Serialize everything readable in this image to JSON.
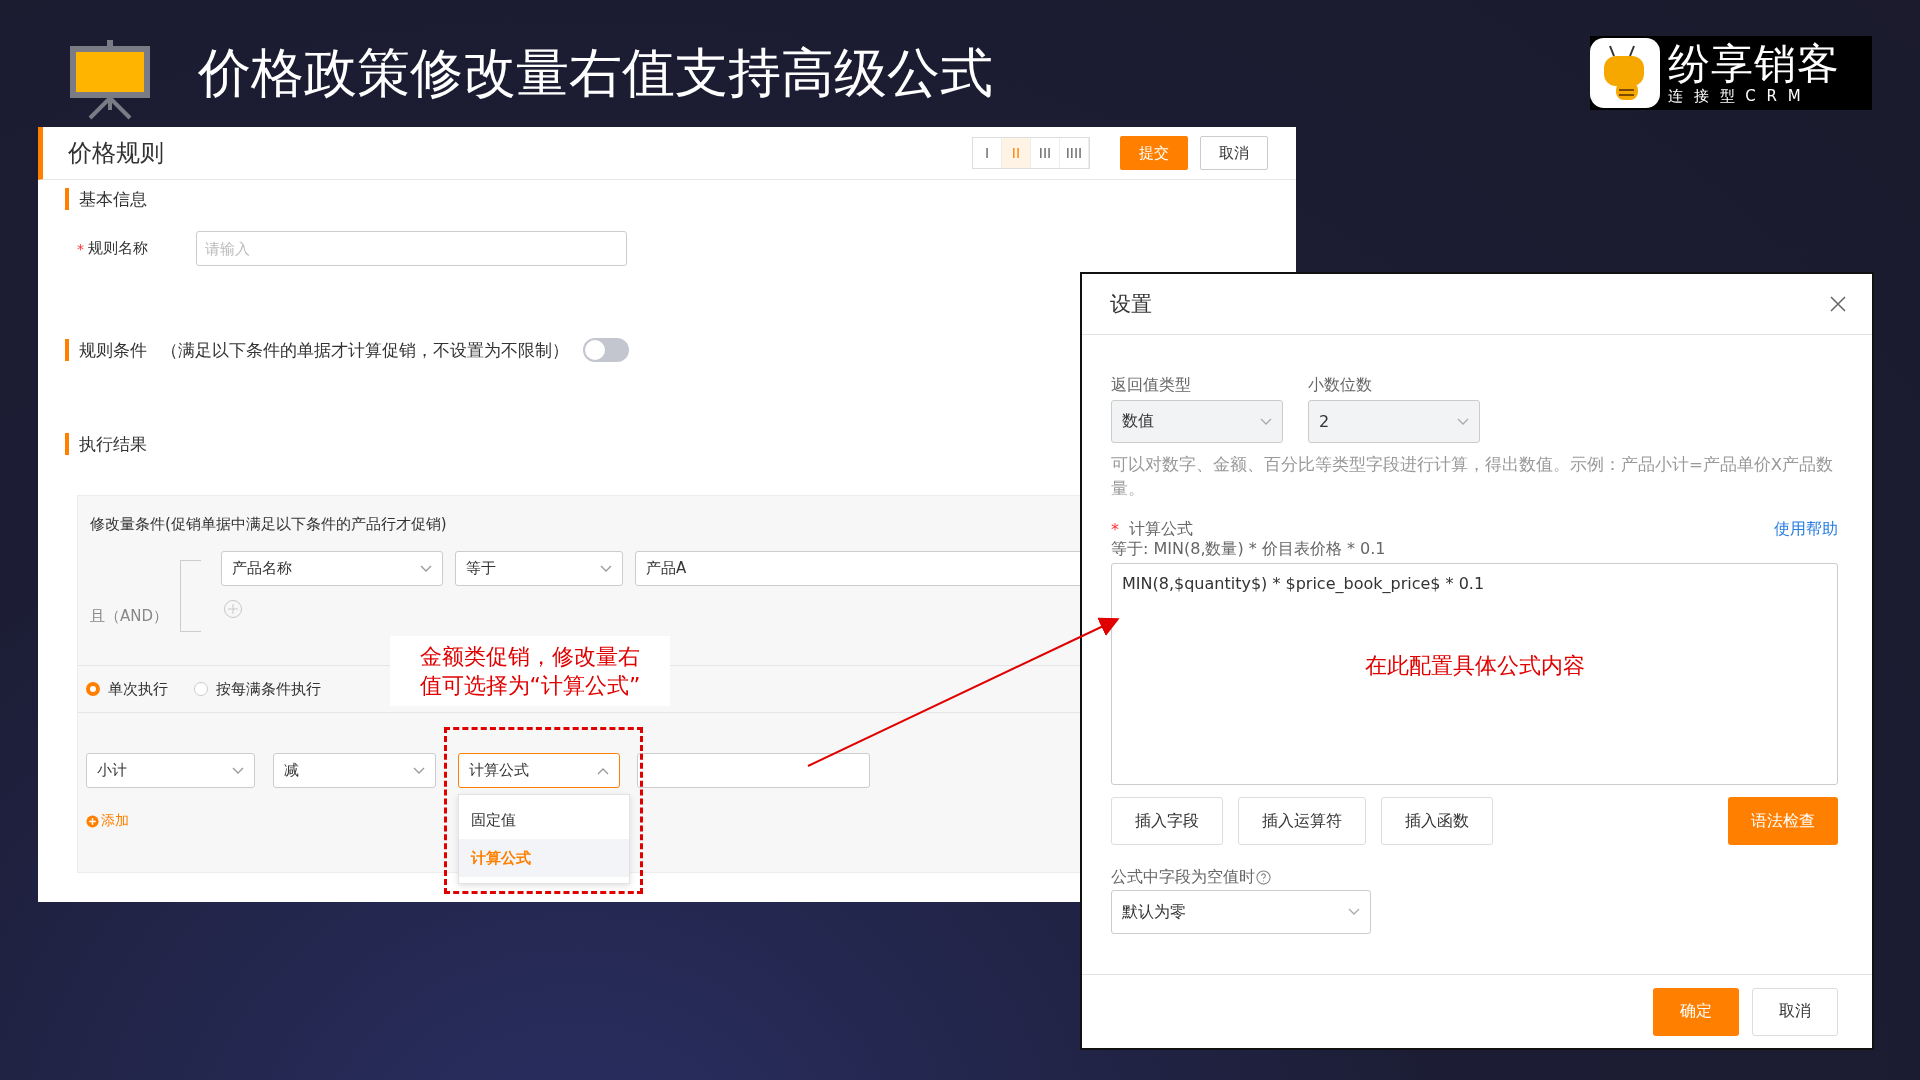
{
  "slide": {
    "title": "价格政策修改量右值支持高级公式",
    "logo": {
      "name": "纷享销客",
      "tagline": "连 接 型 C R M"
    }
  },
  "rule_panel": {
    "title": "价格规则",
    "layout_options": [
      {
        "label": "I",
        "selected": false
      },
      {
        "label": "II",
        "selected": true
      },
      {
        "label": "III",
        "selected": false
      },
      {
        "label": "IIII",
        "selected": false
      }
    ],
    "buttons": [
      {
        "label": "提交",
        "kind": "primary"
      },
      {
        "label": "取消",
        "kind": "default"
      }
    ],
    "basic_info": {
      "heading": "基本信息",
      "field": {
        "required_mark": "*",
        "label": "规则名称",
        "placeholder": "请输入"
      }
    },
    "conditions": {
      "heading": "规则条件",
      "note": "（满足以下条件的单据才计算促销，不设置为不限制）",
      "toggle": {
        "on": false
      }
    },
    "result": {
      "heading": "执行结果",
      "condition_title": "修改量条件(促销单据中满足以下条件的产品行才促销)",
      "logic": "且（AND）",
      "filter": [
        {
          "value": "产品名称",
          "kind": "select"
        },
        {
          "value": "等于",
          "kind": "select"
        },
        {
          "value": "产品A",
          "kind": "input"
        }
      ],
      "radios": [
        {
          "label": "单次执行",
          "selected": true
        },
        {
          "label": "按每满条件执行",
          "selected": false
        }
      ],
      "action_row": [
        {
          "value": "小计",
          "kind": "select",
          "expanded": false
        },
        {
          "value": "减",
          "kind": "select",
          "expanded": false
        },
        {
          "value": "计算公式",
          "kind": "select",
          "expanded": true
        },
        {
          "kind": "input"
        }
      ],
      "add_link": "添加",
      "dropdown": [
        {
          "label": "固定值",
          "selected": false
        },
        {
          "label": "计算公式",
          "selected": true
        }
      ]
    }
  },
  "annotations": {
    "left_callout": [
      "金额类促销，修改量右",
      "值可选择为“计算公式”"
    ],
    "formula_callout": "在此配置具体公式内容"
  },
  "dialog": {
    "title": "设置",
    "return_type": {
      "label": "返回值类型",
      "value": "数值"
    },
    "decimals": {
      "label": "小数位数",
      "value": "2"
    },
    "hint": "可以对数字、金额、百分比等类型字段进行计算，得出数值。示例：产品小计=产品单价X产品数量。",
    "formula": {
      "required_mark": "*",
      "label": "计算公式",
      "help_link": "使用帮助",
      "equals": "等于: MIN(8,数量) * 价目表价格 * 0.1",
      "value": "MIN(8,$quantity$) * $price_book_price$ * 0.1"
    },
    "insert_buttons": [
      "插入字段",
      "插入运算符",
      "插入函数"
    ],
    "check_button": "语法检查",
    "empty_rule": {
      "label": "公式中字段为空值时",
      "value": "默认为零"
    },
    "footer_buttons": [
      {
        "label": "确定",
        "kind": "primary"
      },
      {
        "label": "取消",
        "kind": "default"
      }
    ]
  }
}
